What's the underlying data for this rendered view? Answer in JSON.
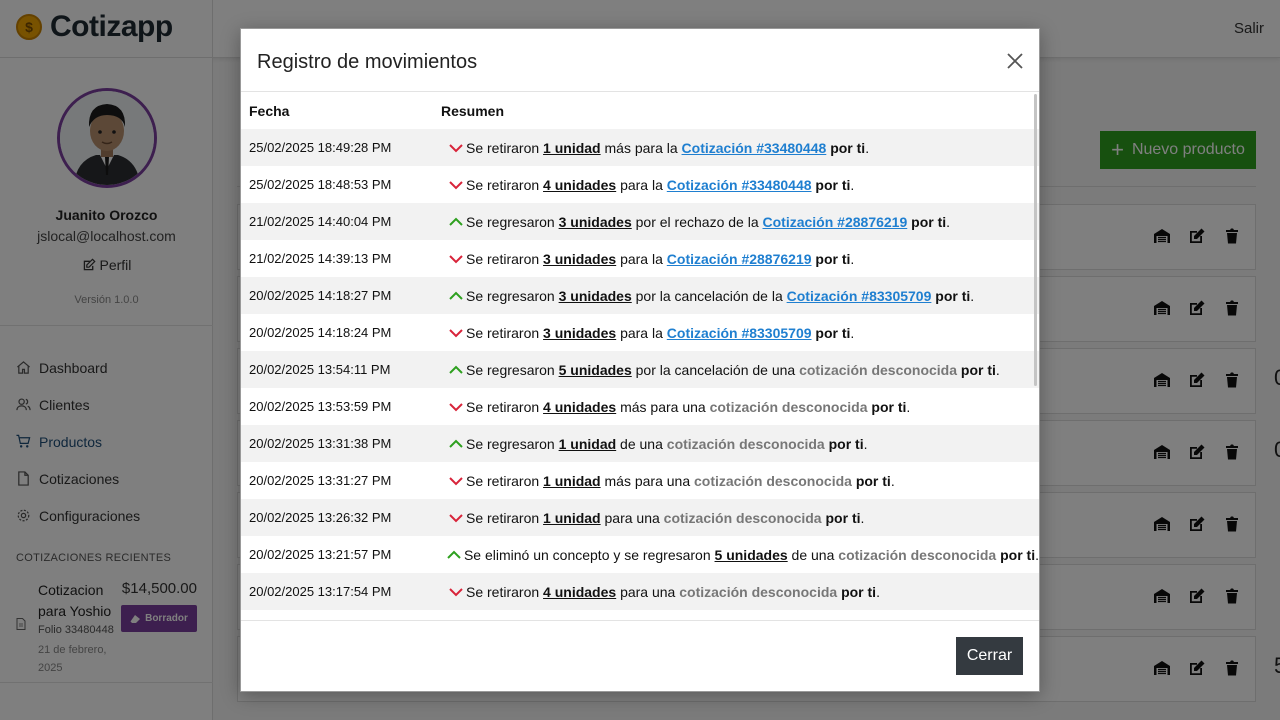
{
  "app": {
    "brand": "Cotizapp",
    "brand_symbol": "$",
    "logout": "Salir",
    "accent_purple": "#7b3f9e",
    "accent_green": "#2ea01f"
  },
  "user": {
    "name": "Juanito Orozco",
    "email": "jslocal@localhost.com",
    "profile_label": "Perfil",
    "version": "Versión 1.0.0"
  },
  "nav": [
    {
      "label": "Dashboard",
      "icon": "home-icon"
    },
    {
      "label": "Clientes",
      "icon": "users-icon"
    },
    {
      "label": "Productos",
      "icon": "cart-icon",
      "active": true
    },
    {
      "label": "Cotizaciones",
      "icon": "file-icon"
    },
    {
      "label": "Configuraciones",
      "icon": "gear-icon"
    }
  ],
  "recent": {
    "title": "COTIZACIONES RECIENTES",
    "item": {
      "name": "Cotizacion para Yoshio",
      "folio": "Folio 33480448",
      "date": "21 de febrero, 2025",
      "amount": "$14,500.00",
      "badge": "Borrador"
    }
  },
  "products": {
    "new_button": "Nuevo producto",
    "fragments": [
      "",
      "",
      "0",
      "0",
      "",
      "",
      "5"
    ]
  },
  "modal": {
    "title": "Registro de movimientos",
    "col_date": "Fecha",
    "col_summary": "Resumen",
    "close_button": "Cerrar",
    "rows": [
      {
        "date": "25/02/2025 18:49:28 PM",
        "dir": "down",
        "parts": [
          {
            "t": "Se retiraron "
          },
          {
            "t": "1 unidad",
            "k": "qty"
          },
          {
            "t": " más para la "
          },
          {
            "t": "Cotización #33480448",
            "k": "link"
          },
          {
            "t": " "
          },
          {
            "t": "por ti",
            "k": "by"
          },
          {
            "t": "."
          }
        ]
      },
      {
        "date": "25/02/2025 18:48:53 PM",
        "dir": "down",
        "parts": [
          {
            "t": "Se retiraron "
          },
          {
            "t": "4 unidades",
            "k": "qty"
          },
          {
            "t": " para la "
          },
          {
            "t": "Cotización #33480448",
            "k": "link"
          },
          {
            "t": " "
          },
          {
            "t": "por ti",
            "k": "by"
          },
          {
            "t": "."
          }
        ]
      },
      {
        "date": "21/02/2025 14:40:04 PM",
        "dir": "up",
        "parts": [
          {
            "t": "Se regresaron "
          },
          {
            "t": "3 unidades",
            "k": "qty"
          },
          {
            "t": " por el rechazo de la "
          },
          {
            "t": "Cotización #28876219",
            "k": "link"
          },
          {
            "t": " "
          },
          {
            "t": "por ti",
            "k": "by"
          },
          {
            "t": "."
          }
        ]
      },
      {
        "date": "21/02/2025 14:39:13 PM",
        "dir": "down",
        "parts": [
          {
            "t": "Se retiraron "
          },
          {
            "t": "3 unidades",
            "k": "qty"
          },
          {
            "t": " para la "
          },
          {
            "t": "Cotización #28876219",
            "k": "link"
          },
          {
            "t": " "
          },
          {
            "t": "por ti",
            "k": "by"
          },
          {
            "t": "."
          }
        ]
      },
      {
        "date": "20/02/2025 14:18:27 PM",
        "dir": "up",
        "parts": [
          {
            "t": "Se regresaron "
          },
          {
            "t": "3 unidades",
            "k": "qty"
          },
          {
            "t": " por la cancelación de la "
          },
          {
            "t": "Cotización #83305709",
            "k": "link"
          },
          {
            "t": " "
          },
          {
            "t": "por ti",
            "k": "by"
          },
          {
            "t": "."
          }
        ]
      },
      {
        "date": "20/02/2025 14:18:24 PM",
        "dir": "down",
        "parts": [
          {
            "t": "Se retiraron "
          },
          {
            "t": "3 unidades",
            "k": "qty"
          },
          {
            "t": " para la "
          },
          {
            "t": "Cotización #83305709",
            "k": "link"
          },
          {
            "t": " "
          },
          {
            "t": "por ti",
            "k": "by"
          },
          {
            "t": "."
          }
        ]
      },
      {
        "date": "20/02/2025 13:54:11 PM",
        "dir": "up",
        "parts": [
          {
            "t": "Se regresaron "
          },
          {
            "t": "5 unidades",
            "k": "qty"
          },
          {
            "t": " por la cancelación de una "
          },
          {
            "t": "cotización desconocida",
            "k": "unk"
          },
          {
            "t": " "
          },
          {
            "t": "por ti",
            "k": "by"
          },
          {
            "t": "."
          }
        ]
      },
      {
        "date": "20/02/2025 13:53:59 PM",
        "dir": "down",
        "parts": [
          {
            "t": "Se retiraron "
          },
          {
            "t": "4 unidades",
            "k": "qty"
          },
          {
            "t": " más para una "
          },
          {
            "t": "cotización desconocida",
            "k": "unk"
          },
          {
            "t": " "
          },
          {
            "t": "por ti",
            "k": "by"
          },
          {
            "t": "."
          }
        ]
      },
      {
        "date": "20/02/2025 13:31:38 PM",
        "dir": "up",
        "parts": [
          {
            "t": "Se regresaron "
          },
          {
            "t": "1 unidad",
            "k": "qty"
          },
          {
            "t": " de una "
          },
          {
            "t": "cotización desconocida",
            "k": "unk"
          },
          {
            "t": " "
          },
          {
            "t": "por ti",
            "k": "by"
          },
          {
            "t": "."
          }
        ]
      },
      {
        "date": "20/02/2025 13:31:27 PM",
        "dir": "down",
        "parts": [
          {
            "t": "Se retiraron "
          },
          {
            "t": "1 unidad",
            "k": "qty"
          },
          {
            "t": " más para una "
          },
          {
            "t": "cotización desconocida",
            "k": "unk"
          },
          {
            "t": " "
          },
          {
            "t": "por ti",
            "k": "by"
          },
          {
            "t": "."
          }
        ]
      },
      {
        "date": "20/02/2025 13:26:32 PM",
        "dir": "down",
        "parts": [
          {
            "t": "Se retiraron "
          },
          {
            "t": "1 unidad",
            "k": "qty"
          },
          {
            "t": " para una "
          },
          {
            "t": "cotización desconocida",
            "k": "unk"
          },
          {
            "t": " "
          },
          {
            "t": "por ti",
            "k": "by"
          },
          {
            "t": "."
          }
        ]
      },
      {
        "date": "20/02/2025 13:21:57 PM",
        "dir": "up",
        "parts": [
          {
            "t": "Se eliminó un concepto y se regresaron "
          },
          {
            "t": "5 unidades",
            "k": "qty"
          },
          {
            "t": " de una "
          },
          {
            "t": "cotización desconocida",
            "k": "unk"
          },
          {
            "t": " "
          },
          {
            "t": "por ti",
            "k": "by"
          },
          {
            "t": "."
          }
        ]
      },
      {
        "date": "20/02/2025 13:17:54 PM",
        "dir": "down",
        "parts": [
          {
            "t": "Se retiraron "
          },
          {
            "t": "4 unidades",
            "k": "qty"
          },
          {
            "t": " para una "
          },
          {
            "t": "cotización desconocida",
            "k": "unk"
          },
          {
            "t": " "
          },
          {
            "t": "por ti",
            "k": "by"
          },
          {
            "t": "."
          }
        ]
      }
    ]
  }
}
